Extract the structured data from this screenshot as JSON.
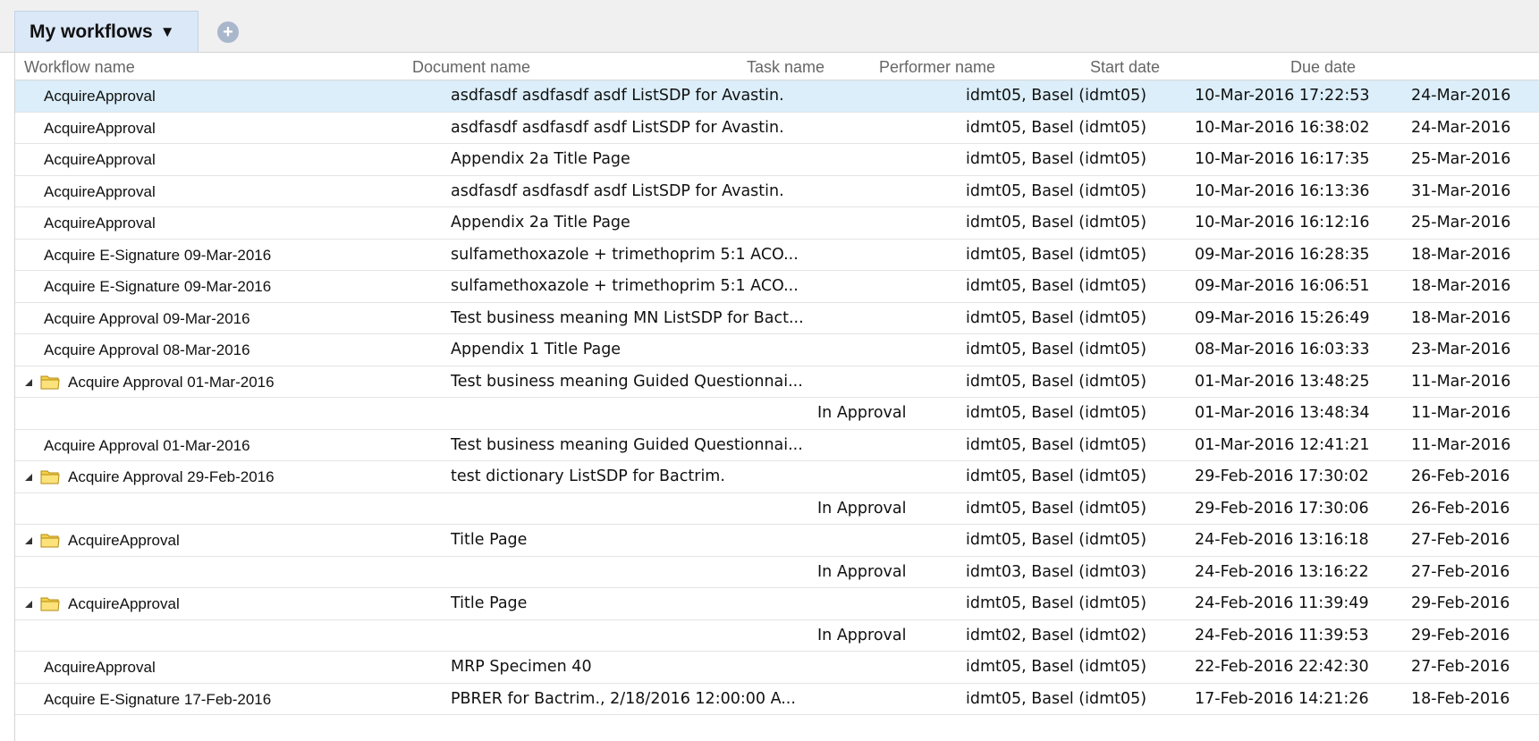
{
  "tab": {
    "label": "My workflows",
    "caret": "▼",
    "add_icon": "+"
  },
  "columns": {
    "workflow": "Workflow name",
    "document": "Document name",
    "task": "Task name",
    "performer": "Performer name",
    "start": "Start date",
    "due": "Due date"
  },
  "rows": [
    {
      "workflow": "AcquireApproval",
      "document": "asdfasdf asdfasdf asdf ListSDP for Avastin.",
      "task": "",
      "performer": "idmt05, Basel (idmt05)",
      "start": "10-Mar-2016 17:22:53",
      "due": "24-Mar-2016",
      "type": "plain",
      "selected": true
    },
    {
      "workflow": "AcquireApproval",
      "document": "asdfasdf asdfasdf asdf ListSDP for Avastin.",
      "task": "",
      "performer": "idmt05, Basel (idmt05)",
      "start": "10-Mar-2016 16:38:02",
      "due": "24-Mar-2016",
      "type": "plain"
    },
    {
      "workflow": "AcquireApproval",
      "document": "Appendix 2a Title Page",
      "task": "",
      "performer": "idmt05, Basel (idmt05)",
      "start": "10-Mar-2016 16:17:35",
      "due": "25-Mar-2016",
      "type": "plain"
    },
    {
      "workflow": "AcquireApproval",
      "document": "asdfasdf asdfasdf asdf ListSDP for Avastin.",
      "task": "",
      "performer": "idmt05, Basel (idmt05)",
      "start": "10-Mar-2016 16:13:36",
      "due": "31-Mar-2016",
      "type": "plain"
    },
    {
      "workflow": "AcquireApproval",
      "document": "Appendix 2a Title Page",
      "task": "",
      "performer": "idmt05, Basel (idmt05)",
      "start": "10-Mar-2016 16:12:16",
      "due": "25-Mar-2016",
      "type": "plain"
    },
    {
      "workflow": "Acquire E-Signature 09-Mar-2016",
      "document": "sulfamethoxazole + trimethoprim 5:1 ACO...",
      "task": "",
      "performer": "idmt05, Basel (idmt05)",
      "start": "09-Mar-2016 16:28:35",
      "due": "18-Mar-2016",
      "type": "plain"
    },
    {
      "workflow": "Acquire E-Signature 09-Mar-2016",
      "document": "sulfamethoxazole + trimethoprim 5:1 ACO...",
      "task": "",
      "performer": "idmt05, Basel (idmt05)",
      "start": "09-Mar-2016 16:06:51",
      "due": "18-Mar-2016",
      "type": "plain"
    },
    {
      "workflow": "Acquire Approval 09-Mar-2016",
      "document": "Test business meaning MN ListSDP for Bact...",
      "task": "",
      "performer": "idmt05, Basel (idmt05)",
      "start": "09-Mar-2016 15:26:49",
      "due": "18-Mar-2016",
      "type": "plain"
    },
    {
      "workflow": "Acquire Approval 08-Mar-2016",
      "document": "Appendix 1 Title Page",
      "task": "",
      "performer": "idmt05, Basel (idmt05)",
      "start": "08-Mar-2016 16:03:33",
      "due": "23-Mar-2016",
      "type": "plain"
    },
    {
      "workflow": "Acquire Approval 01-Mar-2016",
      "document": "Test business meaning Guided Questionnai...",
      "task": "",
      "performer": "idmt05, Basel (idmt05)",
      "start": "01-Mar-2016 13:48:25",
      "due": "11-Mar-2016",
      "type": "folder"
    },
    {
      "workflow": "",
      "document": "",
      "task": "In Approval",
      "performer": "idmt05, Basel (idmt05)",
      "start": "01-Mar-2016 13:48:34",
      "due": "11-Mar-2016",
      "type": "child"
    },
    {
      "workflow": "Acquire Approval 01-Mar-2016",
      "document": "Test business meaning Guided Questionnai...",
      "task": "",
      "performer": "idmt05, Basel (idmt05)",
      "start": "01-Mar-2016 12:41:21",
      "due": "11-Mar-2016",
      "type": "plain"
    },
    {
      "workflow": "Acquire Approval 29-Feb-2016",
      "document": "test dictionary ListSDP for Bactrim.",
      "task": "",
      "performer": "idmt05, Basel (idmt05)",
      "start": "29-Feb-2016 17:30:02",
      "due": "26-Feb-2016",
      "type": "folder"
    },
    {
      "workflow": "",
      "document": "",
      "task": "In Approval",
      "performer": "idmt05, Basel (idmt05)",
      "start": "29-Feb-2016 17:30:06",
      "due": "26-Feb-2016",
      "type": "child"
    },
    {
      "workflow": "AcquireApproval",
      "document": "Title Page",
      "task": "",
      "performer": "idmt05, Basel (idmt05)",
      "start": "24-Feb-2016 13:16:18",
      "due": "27-Feb-2016",
      "type": "folder"
    },
    {
      "workflow": "",
      "document": "",
      "task": "In Approval",
      "performer": "idmt03, Basel (idmt03)",
      "start": "24-Feb-2016 13:16:22",
      "due": "27-Feb-2016",
      "type": "child"
    },
    {
      "workflow": "AcquireApproval",
      "document": "Title Page",
      "task": "",
      "performer": "idmt05, Basel (idmt05)",
      "start": "24-Feb-2016 11:39:49",
      "due": "29-Feb-2016",
      "type": "folder"
    },
    {
      "workflow": "",
      "document": "",
      "task": "In Approval",
      "performer": "idmt02, Basel (idmt02)",
      "start": "24-Feb-2016 11:39:53",
      "due": "29-Feb-2016",
      "type": "child"
    },
    {
      "workflow": "AcquireApproval",
      "document": "MRP Specimen 40",
      "task": "",
      "performer": "idmt05, Basel (idmt05)",
      "start": "22-Feb-2016 22:42:30",
      "due": "27-Feb-2016",
      "type": "plain"
    },
    {
      "workflow": "Acquire E-Signature 17-Feb-2016",
      "document": "PBRER for Bactrim., 2/18/2016 12:00:00 A...",
      "task": "",
      "performer": "idmt05, Basel (idmt05)",
      "start": "17-Feb-2016 14:21:26",
      "due": "18-Feb-2016",
      "type": "plain"
    }
  ]
}
